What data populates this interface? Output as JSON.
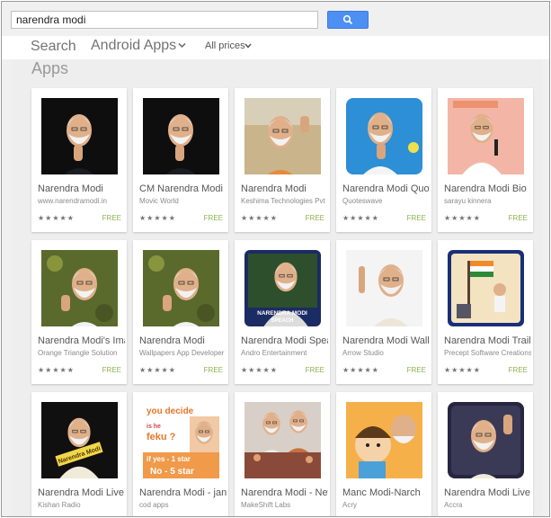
{
  "search": {
    "query": "narendra modi"
  },
  "nav": {
    "search_label": "Search",
    "category_label": "Android Apps",
    "price_filter": "All prices"
  },
  "section": {
    "title": "Apps"
  },
  "colors": {
    "search_button": "#4d8ff3",
    "free_label": "#8bb34d"
  },
  "apps": [
    {
      "title": "Narendra Modi",
      "developer": "www.narendramodi.in",
      "price": "FREE",
      "icon": "portrait-dark-bg"
    },
    {
      "title": "CM Narendra Modi",
      "developer": "Movic World",
      "price": "FREE",
      "icon": "portrait-dark-bg"
    },
    {
      "title": "Narendra Modi",
      "developer": "Keshima Technologies Pvt",
      "price": "FREE",
      "icon": "portrait-waving"
    },
    {
      "title": "Narendra Modi Quotes",
      "developer": "Quoteswave",
      "price": "FREE",
      "icon": "portrait-blue-bg"
    },
    {
      "title": "Narendra Modi Bio",
      "developer": "sarayu kinnera",
      "price": "FREE",
      "icon": "portrait-speech-pink"
    },
    {
      "title": "Narendra Modi's Images",
      "developer": "Orange Triangle Solution",
      "price": "FREE",
      "icon": "portrait-green-bokeh"
    },
    {
      "title": "Narendra Modi",
      "developer": "Wallpapers App Developer",
      "price": "FREE",
      "icon": "portrait-green-bokeh"
    },
    {
      "title": "Narendra Modi Speach",
      "developer": "Andro Entertainment",
      "price": "FREE",
      "icon": "portrait-framed-speach"
    },
    {
      "title": "Narendra Modi Wallpapers",
      "developer": "Arrow Studio",
      "price": "FREE",
      "icon": "portrait-finger"
    },
    {
      "title": "Narendra Modi Trail",
      "developer": "Precept Software Creations",
      "price": "FREE",
      "icon": "cartoon-flag"
    },
    {
      "title": "Narendra Modi Live",
      "developer": "Kishan Radio",
      "price": "",
      "icon": "portrait-dark-label"
    },
    {
      "title": "Narendra Modi - jan",
      "developer": "cod apps",
      "price": "",
      "icon": "feku-poster"
    },
    {
      "title": "Narendra Modi - News",
      "developer": "MakeShift Labs",
      "price": "",
      "icon": "portrait-crowd"
    },
    {
      "title": "Manc Modi-Narch",
      "developer": "Acry",
      "price": "",
      "icon": "cartoon-pair"
    },
    {
      "title": "Narendra Modi Live",
      "developer": "Accra",
      "price": "",
      "icon": "portrait-waving-dark"
    }
  ],
  "thumb_text": {
    "speach_line1": "NARENDRA MODI",
    "speach_line2": "SPEACH",
    "dark_label": "Narendra Modi",
    "poster_line1": "you decide",
    "poster_line2": "is he",
    "poster_line3": "feku ?",
    "poster_line4": "if yes - 1 star",
    "poster_line5": "No - 5 star"
  }
}
